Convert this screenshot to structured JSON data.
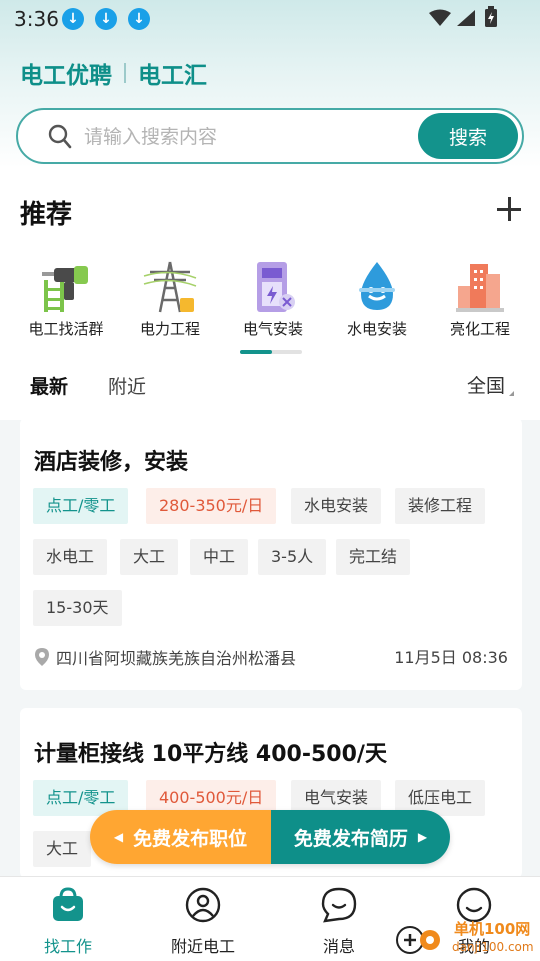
{
  "status": {
    "time": "3:36",
    "download_icon": "↓"
  },
  "brand": {
    "name1": "电工优聘",
    "name2": "电工汇"
  },
  "search": {
    "placeholder": "请输入搜索内容",
    "button": "搜索"
  },
  "recommend": {
    "title": "推荐"
  },
  "categories": [
    {
      "label": "电工找活群",
      "icon": "drill-ladder-icon"
    },
    {
      "label": "电力工程",
      "icon": "power-tower-icon"
    },
    {
      "label": "电气安装",
      "icon": "electric-cabinet-icon"
    },
    {
      "label": "水电安装",
      "icon": "water-drop-icon"
    },
    {
      "label": "亮化工程",
      "icon": "buildings-icon"
    }
  ],
  "tabs": {
    "latest": "最新",
    "nearby": "附近",
    "region": "全国"
  },
  "jobs": [
    {
      "title": "酒店装修，安装",
      "tags": [
        "点工/零工",
        "280-350元/日",
        "水电安装",
        "装修工程",
        "水电工",
        "大工",
        "中工",
        "3-5人",
        "完工结",
        "15-30天"
      ],
      "location": "四川省阿坝藏族羌族自治州松潘县",
      "time": "11月5日 08:36"
    },
    {
      "title": "计量柜接线 10平方线 400-500/天",
      "tags": [
        "点工/零工",
        "400-500元/日",
        "电气安装",
        "低压电工",
        "大工"
      ]
    }
  ],
  "publish": {
    "job": "免费发布职位",
    "resume": "免费发布简历"
  },
  "nav": [
    {
      "label": "找工作",
      "icon": "shopping-bag-icon"
    },
    {
      "label": "附近电工",
      "icon": "person-icon"
    },
    {
      "label": "消息",
      "icon": "chat-bubble-icon"
    },
    {
      "label": "我的",
      "icon": "profile-smile-icon"
    }
  ],
  "watermark": {
    "text1": "单机100网",
    "text2": "danji100.com"
  },
  "colors": {
    "primary": "#13938c",
    "accent_orange": "#ffa632",
    "price_red": "#e0593a"
  }
}
